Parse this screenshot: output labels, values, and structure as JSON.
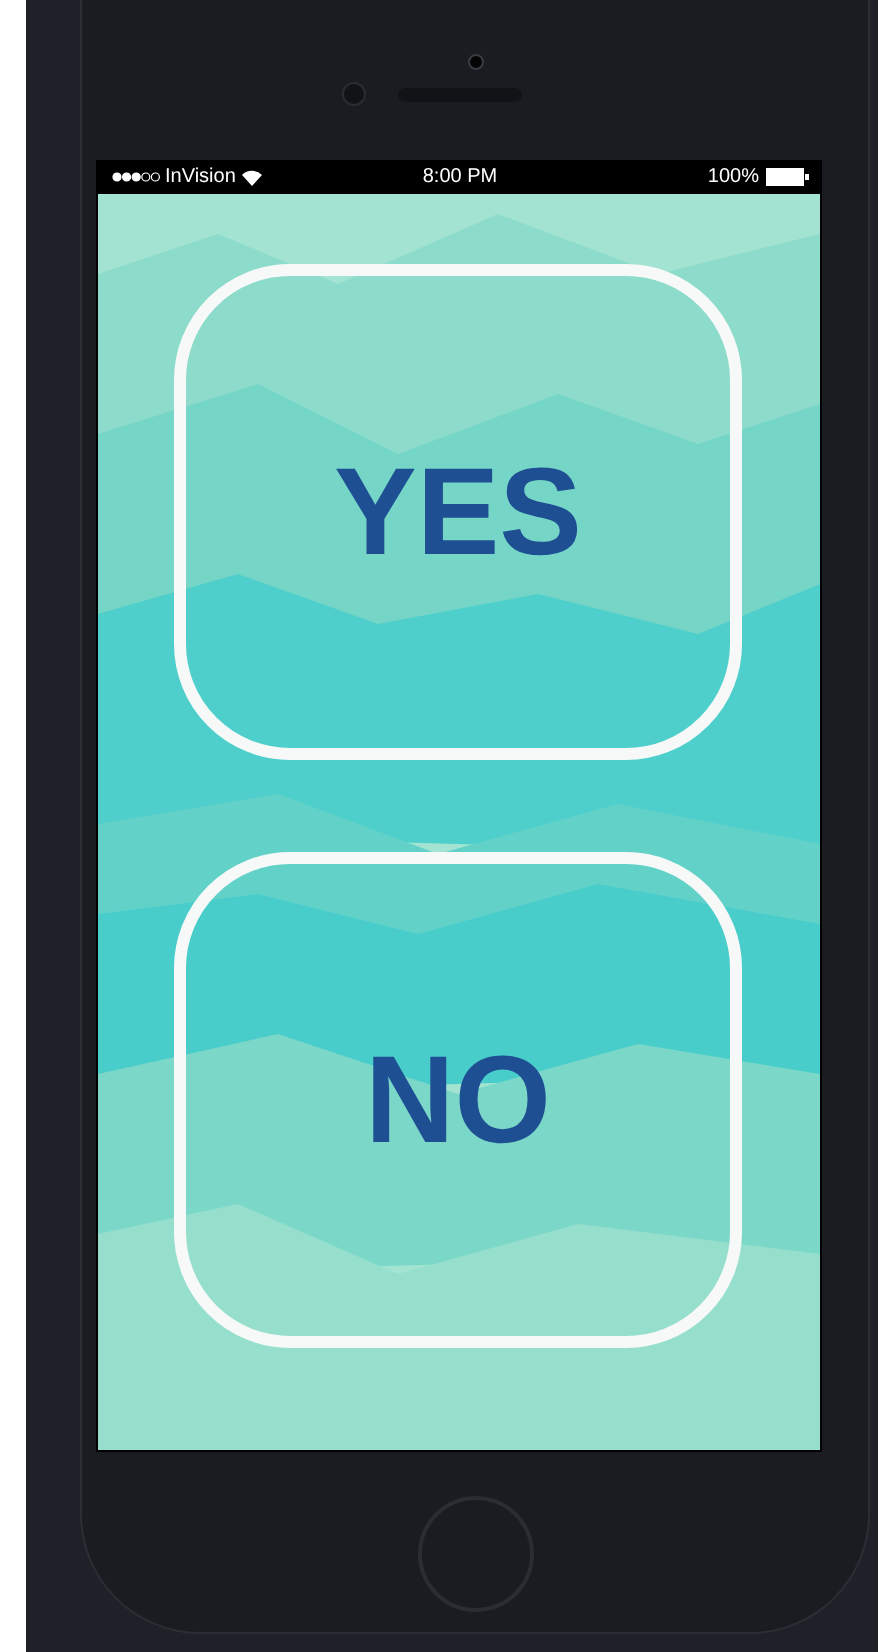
{
  "status_bar": {
    "carrier": "InVision",
    "time": "8:00 PM",
    "battery": "100%"
  },
  "buttons": [
    {
      "label": "YES"
    },
    {
      "label": "NO"
    }
  ]
}
